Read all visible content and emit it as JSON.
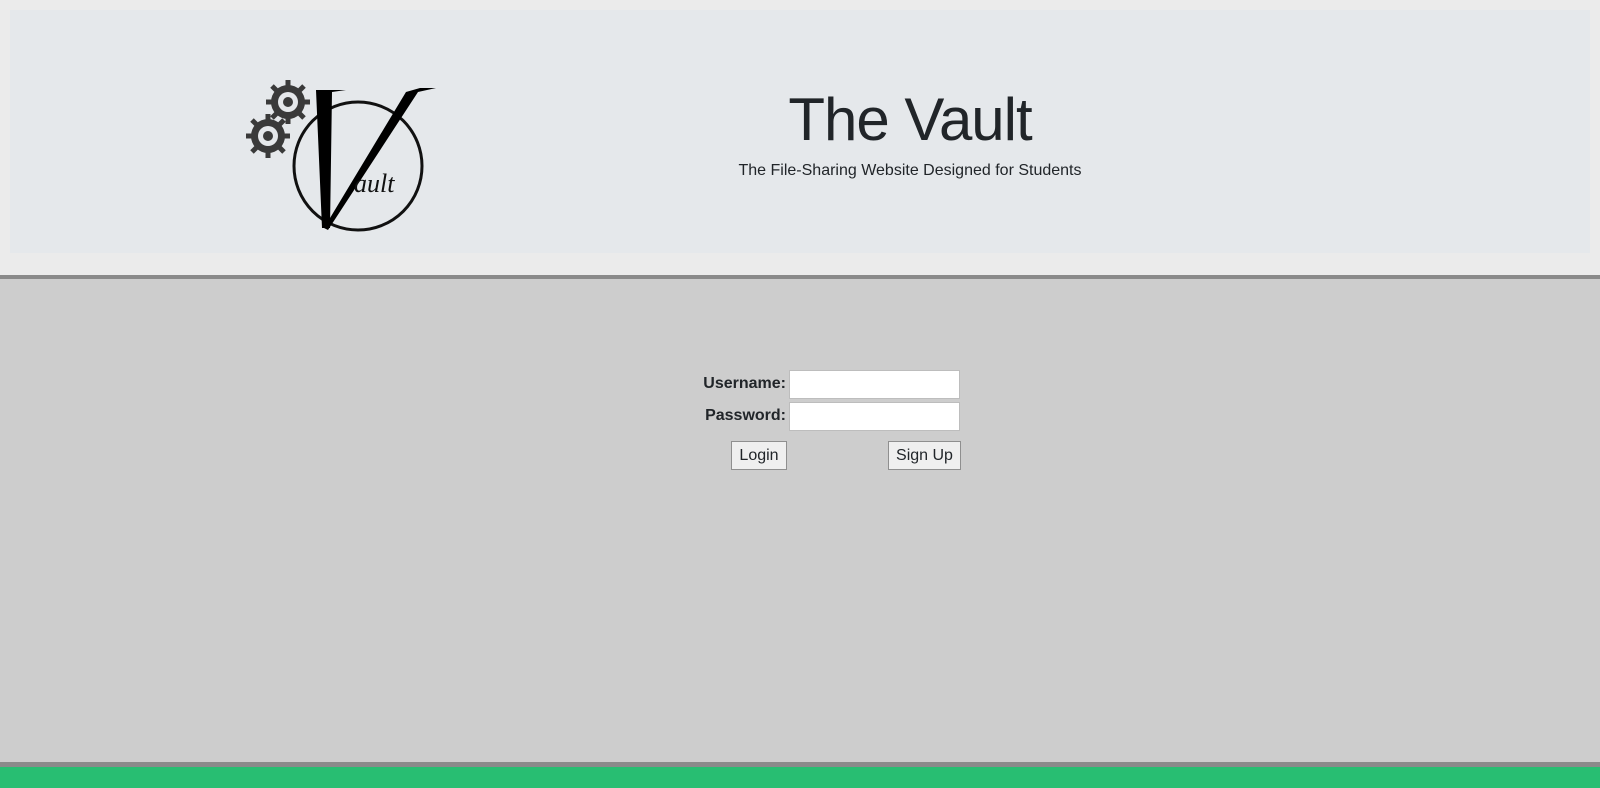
{
  "header": {
    "title": "The Vault",
    "subtitle": "The File-Sharing Website Designed for Students",
    "logo": {
      "letter": "V",
      "text": "ault"
    }
  },
  "login": {
    "username_label": "Username:",
    "password_label": "Password:",
    "username_value": "",
    "password_value": "",
    "login_label": "Login",
    "signup_label": "Sign Up"
  },
  "colors": {
    "header_bg": "#e5e8eb",
    "main_bg": "#cdcdcd",
    "rule": "#8a8a8a",
    "footer": "#28be72"
  }
}
